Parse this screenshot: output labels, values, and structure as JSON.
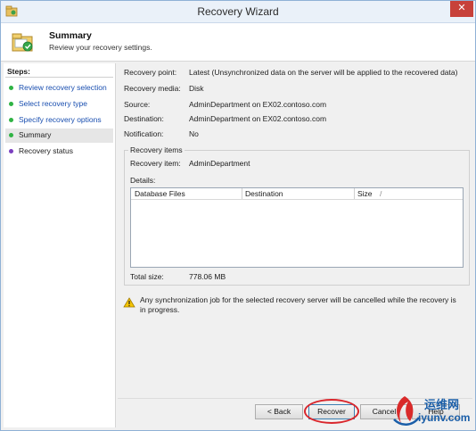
{
  "window": {
    "title": "Recovery Wizard",
    "close_glyph": "✕"
  },
  "header": {
    "title": "Summary",
    "subtitle": "Review your recovery settings."
  },
  "steps": {
    "title": "Steps:",
    "items": [
      {
        "label": "Review recovery selection",
        "state": "done"
      },
      {
        "label": "Select recovery type",
        "state": "done"
      },
      {
        "label": "Specify recovery options",
        "state": "done"
      },
      {
        "label": "Summary",
        "state": "current"
      },
      {
        "label": "Recovery status",
        "state": "pending"
      }
    ]
  },
  "summary": {
    "rows": [
      {
        "label": "Recovery point:",
        "value": "Latest (Unsynchronized data on the server will be applied to the recovered data)"
      },
      {
        "label": "Recovery media:",
        "value": "Disk"
      },
      {
        "label": "Source:",
        "value": "AdminDepartment on EX02.contoso.com"
      },
      {
        "label": "Destination:",
        "value": "AdminDepartment on EX02.contoso.com"
      },
      {
        "label": "Notification:",
        "value": "No"
      }
    ]
  },
  "recovery_items": {
    "title": "Recovery items",
    "item_label": "Recovery item:",
    "item_value": "AdminDepartment",
    "details_label": "Details:",
    "columns": [
      "Database Files",
      "Destination",
      "Size"
    ],
    "sort_glyph": "/",
    "total_label": "Total size:",
    "total_value": "778.06 MB"
  },
  "warning": {
    "text": "Any synchronization job for the selected recovery server will be cancelled while the recovery is in progress."
  },
  "buttons": {
    "back": "< Back",
    "recover": "Recover",
    "cancel": "Cancel",
    "help": "Help"
  },
  "watermark": {
    "line1": "运维网",
    "line2": "iyunv.com"
  },
  "colors": {
    "done_dot": "#2fb344",
    "pending_dot": "#7b3fbf",
    "link": "#1a4fb0",
    "annotation": "#d9262c"
  }
}
